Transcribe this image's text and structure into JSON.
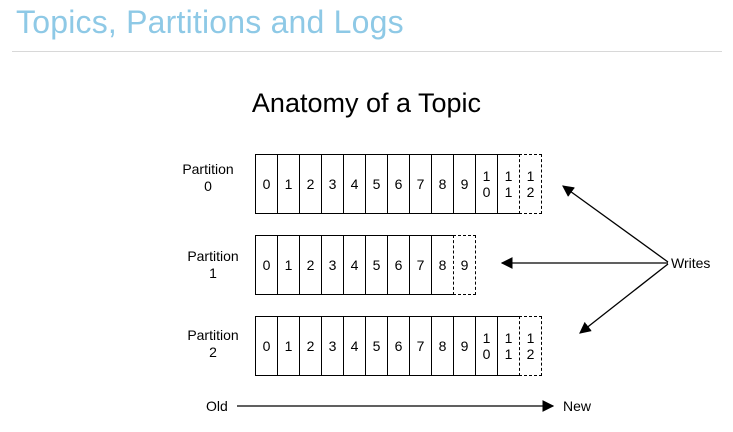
{
  "slide": {
    "title": "Topics, Partitions and Logs"
  },
  "diagram": {
    "title": "Anatomy of a Topic",
    "partitions": [
      {
        "label": [
          "Partition",
          "0"
        ],
        "offsets": [
          "0",
          "1",
          "2",
          "3",
          "4",
          "5",
          "6",
          "7",
          "8",
          "9",
          "10",
          "11"
        ],
        "next_write": "12"
      },
      {
        "label": [
          "Partition",
          "1"
        ],
        "offsets": [
          "0",
          "1",
          "2",
          "3",
          "4",
          "5",
          "6",
          "7",
          "8"
        ],
        "next_write": "9"
      },
      {
        "label": [
          "Partition",
          "2"
        ],
        "offsets": [
          "0",
          "1",
          "2",
          "3",
          "4",
          "5",
          "6",
          "7",
          "8",
          "9",
          "10",
          "11"
        ],
        "next_write": "12"
      }
    ],
    "writes_label": "Writes",
    "old_label": "Old",
    "new_label": "New"
  }
}
